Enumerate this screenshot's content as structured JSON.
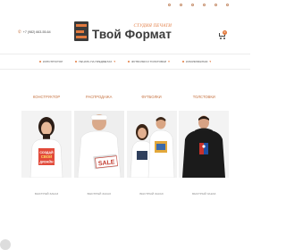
{
  "topbar": {
    "links": [
      "",
      "",
      "",
      "",
      "",
      ""
    ]
  },
  "header": {
    "phone": "+7 (982) 663-55-64",
    "logo_subtitle": "СТУДИЯ ПЕЧАТИ",
    "logo_title": "Твой Формат",
    "cart_count": "0"
  },
  "nav": {
    "items": [
      {
        "label": "КОНСТРУКТОР",
        "has_dropdown": false
      },
      {
        "label": "ПЕЧАТЬ НА ПРЕДМЕТАХ",
        "has_dropdown": true
      },
      {
        "label": "ФУТБОЛКИ И ТОЛСТОВКИ",
        "has_dropdown": true
      },
      {
        "label": "КОМУФЛЯЖНАЯ",
        "has_dropdown": true
      }
    ]
  },
  "catalog": [
    {
      "title": "КОНСТРУКТОР",
      "button": "БЫСТРЫЙ ЗАКАЗ",
      "image": "girl-in-custom-tshirt",
      "print_text": "СОЗДАЙ СВОЙ ДИЗАЙН"
    },
    {
      "title": "РАСПРОДАЖА",
      "button": "БЫСТРЫЙ ЗАКАЗ",
      "image": "sale-tshirt",
      "print_text": "SALE"
    },
    {
      "title": "ФУТБОЛКИ",
      "button": "БЫСТРЫЙ ЗАКАЗ",
      "image": "couple-in-tshirts",
      "print_text": ""
    },
    {
      "title": "ТОЛСТОВКИ",
      "button": "БЫСТРЫЙ ЗАКАЗ",
      "image": "man-in-hoodie",
      "print_text": ""
    }
  ],
  "colors": {
    "accent": "#e27a3f",
    "dark": "#3a3a3a",
    "muted": "#8a8a8a"
  }
}
